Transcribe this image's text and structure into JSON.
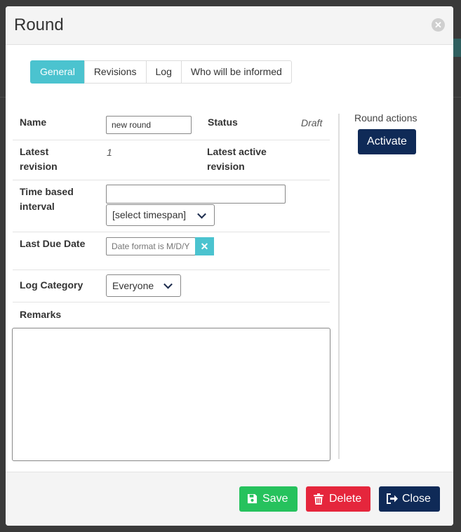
{
  "dialog": {
    "title": "Round"
  },
  "tabs": [
    {
      "label": "General",
      "active": true
    },
    {
      "label": "Revisions",
      "active": false
    },
    {
      "label": "Log",
      "active": false
    },
    {
      "label": "Who will be informed",
      "active": false
    }
  ],
  "form": {
    "name_label": "Name",
    "name_value": "new round",
    "status_label": "Status",
    "status_value": "Draft",
    "latest_revision_label": "Latest revision",
    "latest_revision_value": "1",
    "latest_active_revision_label": "Latest active revision",
    "time_interval_label": "Time based interval",
    "time_interval_value": "",
    "timespan_selected": "[select timespan]",
    "last_due_date_label": "Last Due Date",
    "last_due_date_placeholder": "Date format is M/D/Y",
    "log_category_label": "Log Category",
    "log_category_selected": "Everyone",
    "remarks_label": "Remarks",
    "remarks_value": ""
  },
  "actions": {
    "title": "Round actions",
    "activate_label": "Activate"
  },
  "footer": {
    "save_label": "Save",
    "delete_label": "Delete",
    "close_label": "Close"
  },
  "colors": {
    "accent": "#4bc3cf",
    "primary_dark": "#0f2a57",
    "save_green": "#26c25d",
    "delete_red": "#e5263c"
  }
}
